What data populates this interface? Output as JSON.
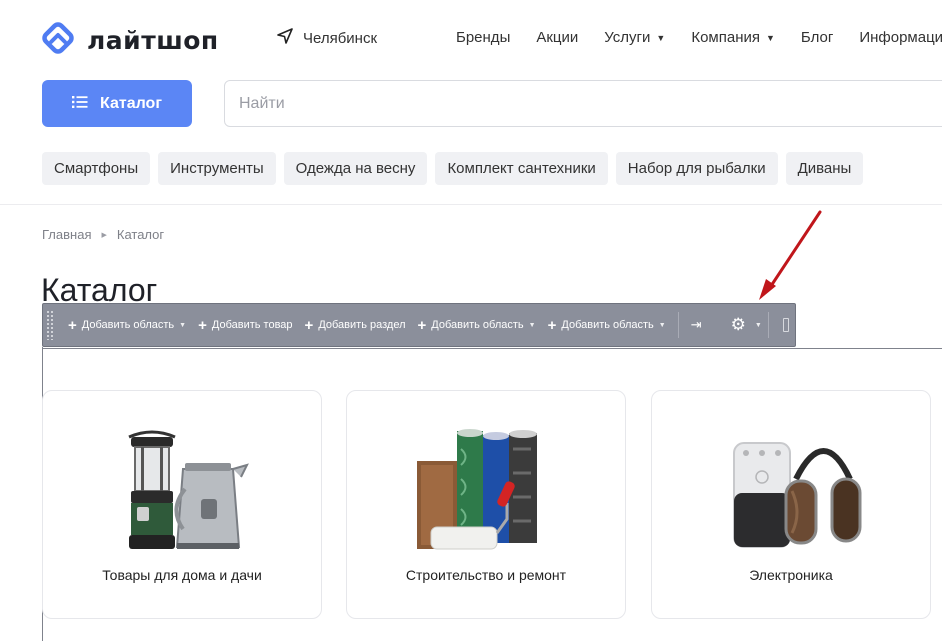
{
  "header": {
    "logo_text": "лайтшоп",
    "city": "Челябинск",
    "nav": [
      {
        "label": "Бренды",
        "has_dropdown": false
      },
      {
        "label": "Акции",
        "has_dropdown": false
      },
      {
        "label": "Услуги",
        "has_dropdown": true
      },
      {
        "label": "Компания",
        "has_dropdown": true
      },
      {
        "label": "Блог",
        "has_dropdown": false
      },
      {
        "label": "Информация",
        "has_dropdown": false
      }
    ]
  },
  "catalog_button": {
    "label": "Каталог",
    "icon": "list-icon",
    "color": "#5b86f5"
  },
  "search": {
    "placeholder": "Найти",
    "value": ""
  },
  "tags": [
    "Смартфоны",
    "Инструменты",
    "Одежда на весну",
    "Комплект сантехники",
    "Набор для рыбалки",
    "Диваны"
  ],
  "breadcrumb": [
    "Главная",
    "Каталог"
  ],
  "page_title": "Каталог",
  "admin_toolbar": {
    "buttons": [
      {
        "label": "Добавить область",
        "has_dropdown": true
      },
      {
        "label": "Добавить товар",
        "has_dropdown": false
      },
      {
        "label": "Добавить раздел",
        "has_dropdown": false
      },
      {
        "label": "Добавить область",
        "has_dropdown": true
      },
      {
        "label": "Добавить область",
        "has_dropdown": true
      }
    ],
    "icons": [
      "pin-icon",
      "gear-icon"
    ]
  },
  "annotation": {
    "type": "arrow",
    "color": "#c0161b"
  },
  "categories": [
    {
      "label": "Товары для дома и дачи",
      "icon": "lantern-kettle-image"
    },
    {
      "label": "Строительство и ремонт",
      "icon": "wallpaper-roller-image"
    },
    {
      "label": "Электроника",
      "icon": "speaker-headphones-image"
    }
  ]
}
